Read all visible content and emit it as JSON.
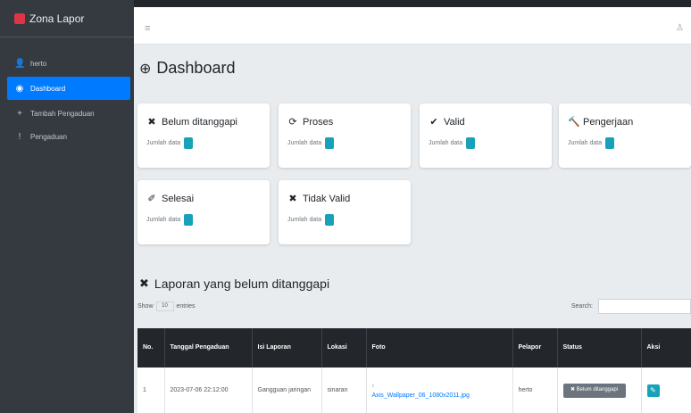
{
  "brand": {
    "name": "Zona Lapor"
  },
  "sidebar": {
    "items": [
      {
        "label": "herto",
        "icon": "user-icon",
        "glyph": "👤"
      },
      {
        "label": "Dashboard",
        "icon": "dashboard-icon",
        "glyph": "◉",
        "active": true
      },
      {
        "label": "Tambah Pengaduan",
        "icon": "plus-icon",
        "glyph": "+"
      },
      {
        "label": "Pengaduan",
        "icon": "exclamation-icon",
        "glyph": "!"
      }
    ]
  },
  "topbar": {
    "menu_glyph": "≡",
    "right_glyph": "♙"
  },
  "page": {
    "title": "Dashboard",
    "title_glyph": "⊕"
  },
  "cards": [
    {
      "title": "Belum ditanggapi",
      "glyph": "✖",
      "sub": "Jumlah data",
      "icon": "times-icon"
    },
    {
      "title": "Proses",
      "glyph": "⟳",
      "sub": "Jumlah data",
      "icon": "sync-icon"
    },
    {
      "title": "Valid",
      "glyph": "✔",
      "sub": "Jumlah data",
      "icon": "check-icon"
    },
    {
      "title": "Pengerjaan",
      "glyph": "🔨",
      "sub": "Jumlah data",
      "icon": "hammer-icon"
    },
    {
      "title": "Selesai",
      "glyph": "✐",
      "sub": "Jumlah data",
      "icon": "feather-icon"
    },
    {
      "title": "Tidak Valid",
      "glyph": "✖",
      "sub": "Jumlah data",
      "icon": "times-icon"
    }
  ],
  "section": {
    "title": "Laporan yang belum ditanggapi",
    "glyph": "✖"
  },
  "datatable": {
    "show_label": "Show",
    "length_value": "10",
    "entries_label": "entries",
    "search_label": "Search:",
    "columns": [
      "No.",
      "Tanggal Pengaduan",
      "Isi Laporan",
      "Lokasi",
      "Foto",
      "Pelapor",
      "Status",
      "Aksi"
    ],
    "rows": [
      {
        "no": "1",
        "tanggal": "2023-07-06 22:12:00",
        "isi": "Gangguan jaringan",
        "lokasi": "sinaran",
        "foto": "Axis_Wallpaper_06_1080x2011.jpg",
        "pelapor": "herto",
        "status": "✖ Belum ditanggapi",
        "aksi_glyph": "✎"
      }
    ]
  },
  "colors": {
    "sidebar": "#343a40",
    "accent": "#007bff",
    "badge": "#17a2b8",
    "status": "#6c757d"
  }
}
